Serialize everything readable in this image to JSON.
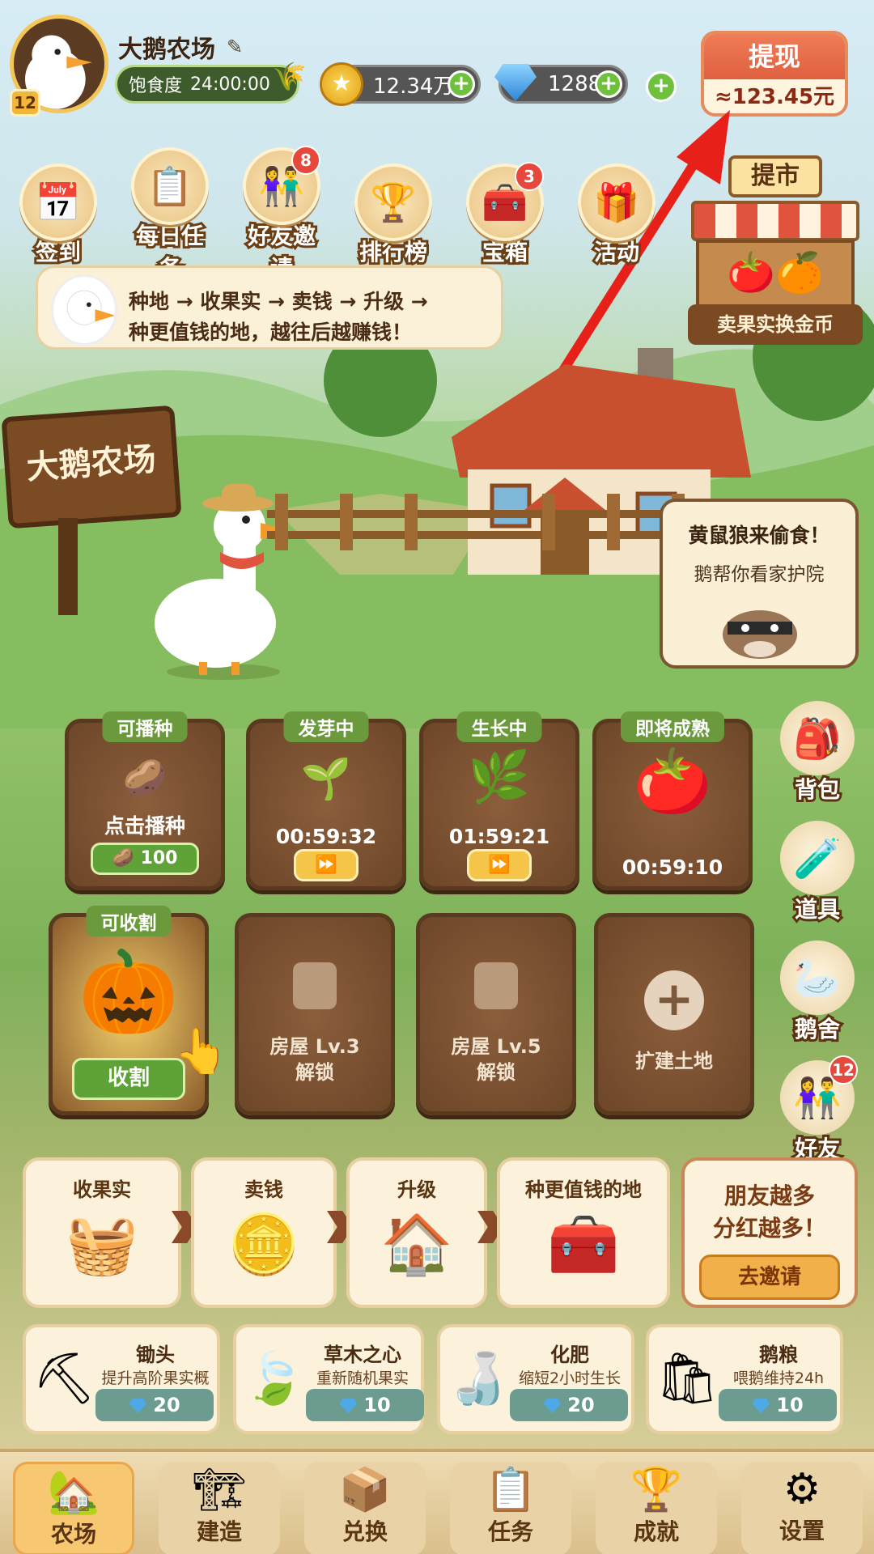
{
  "header": {
    "farm_name": "大鹅农场",
    "level": "12",
    "satiety_label": "饱食度",
    "satiety_time": "24:00:00",
    "coins": "12.34万",
    "gems": "1288",
    "withdraw_label": "提现",
    "withdraw_amount": "≈123.45元"
  },
  "top_icons": [
    {
      "label": "签到",
      "icon": "calendar-icon"
    },
    {
      "label": "每日任务",
      "icon": "checklist-icon"
    },
    {
      "label": "好友邀请",
      "icon": "friends-icon",
      "badge": "8"
    },
    {
      "label": "排行榜",
      "icon": "trophy-icon"
    },
    {
      "label": "宝箱",
      "icon": "treasure-chest-icon",
      "badge": "3"
    },
    {
      "label": "活动",
      "icon": "gift-icon"
    }
  ],
  "market": {
    "title": "提市",
    "label": "卖果实换金币"
  },
  "tip": {
    "line1": "种地 → 收果实 → 卖钱 → 升级 →",
    "line2": "种更值钱的地，越往后越赚钱！"
  },
  "sign": {
    "text": "大鹅农场"
  },
  "weasel_card": {
    "title": "黄鼠狼来偷食！",
    "subtitle": "鹅帮你看家护院"
  },
  "plots": [
    {
      "tag": "可播种",
      "label": "点击播种",
      "cost": "100",
      "state": "empty"
    },
    {
      "tag": "发芽中",
      "timer": "00:59:32",
      "state": "sprouting"
    },
    {
      "tag": "生长中",
      "timer": "01:59:21",
      "state": "growing"
    },
    {
      "tag": "即将成熟",
      "timer": "00:59:10",
      "state": "ripening"
    },
    {
      "tag": "可收割",
      "button": "收割",
      "state": "harvest"
    },
    {
      "line1": "房屋 Lv.3",
      "line2": "解锁",
      "state": "locked"
    },
    {
      "line1": "房屋 Lv.5",
      "line2": "解锁",
      "state": "locked"
    },
    {
      "label": "扩建土地",
      "state": "expand"
    }
  ],
  "side_buttons": [
    {
      "label": "背包",
      "icon": "backpack-icon"
    },
    {
      "label": "道具",
      "icon": "potion-icon"
    },
    {
      "label": "鹅舍",
      "icon": "goose-icon"
    },
    {
      "label": "好友",
      "icon": "friends-icon",
      "badge": "12"
    }
  ],
  "flow": [
    {
      "label": "收果实",
      "icon": "fruit-basket-icon"
    },
    {
      "label": "卖钱",
      "icon": "gold-coins-icon"
    },
    {
      "label": "升级",
      "icon": "house-icon"
    },
    {
      "label": "种更值钱的地",
      "icon": "treasure-chest-icon"
    }
  ],
  "invite": {
    "line1": "朋友越多",
    "line2": "分红越多！",
    "button": "去邀请"
  },
  "items": [
    {
      "name": "锄头",
      "desc": "提升高阶果实概率",
      "price": "20",
      "icon": "hoe-icon"
    },
    {
      "name": "草木之心",
      "desc": "重新随机果实",
      "price": "10",
      "icon": "leaf-icon"
    },
    {
      "name": "化肥",
      "desc": "缩短2小时生长",
      "price": "20",
      "icon": "fertilizer-bottle-icon"
    },
    {
      "name": "鹅粮",
      "desc": "喂鹅维持24h",
      "price": "10",
      "icon": "feed-bag-icon"
    }
  ],
  "nav": [
    {
      "label": "农场",
      "icon": "farm-house-icon",
      "active": true
    },
    {
      "label": "建造",
      "icon": "build-icon"
    },
    {
      "label": "兑换",
      "icon": "exchange-icon"
    },
    {
      "label": "任务",
      "icon": "clipboard-icon"
    },
    {
      "label": "成就",
      "icon": "trophy-icon"
    },
    {
      "label": "设置",
      "icon": "gear-icon"
    }
  ],
  "colors": {
    "accent": "#e0603f",
    "green": "#5fa338",
    "wood": "#7b4b24"
  }
}
